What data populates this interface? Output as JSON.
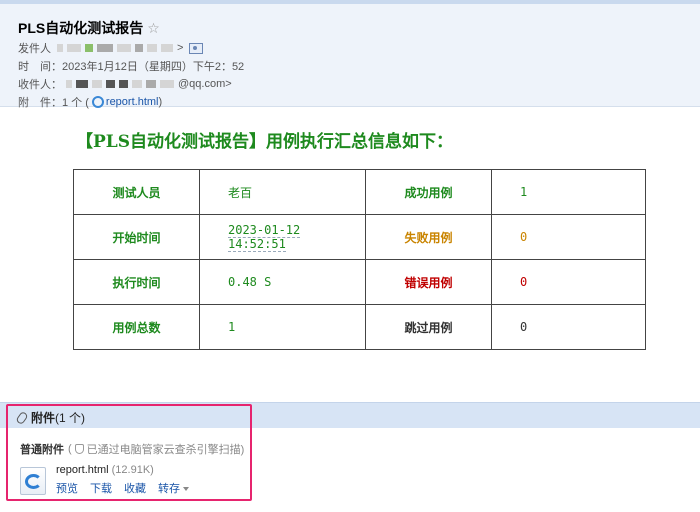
{
  "mail": {
    "subject": "PLS自动化测试报告",
    "star_icon": "☆",
    "sender_label": "发件人",
    "sender_suffix": ">",
    "time_label": "时　间：",
    "time_value": "2023年1月12日（星期四）下午2：52",
    "recipient_label": "收件人：",
    "recipient_suffix": "@qq.com>",
    "attachment_label": "附　件：",
    "attachment_count": "1 个 (",
    "attachment_file": "report.html",
    "attachment_close": ")"
  },
  "report": {
    "title": "【PLS自动化测试报告】用例执行汇总信息如下：",
    "rows": [
      {
        "k1": "测试人员",
        "v1": "老百",
        "k2": "成功用例",
        "v2": "1"
      },
      {
        "k1": "开始时间",
        "v1": "2023-01-12 14:52:51",
        "k2": "失败用例",
        "v2": "0"
      },
      {
        "k1": "执行时间",
        "v1": "0.48 S",
        "k2": "错误用例",
        "v2": "0"
      },
      {
        "k1": "用例总数",
        "v1": "1",
        "k2": "跳过用例",
        "v2": "0"
      }
    ]
  },
  "attachments": {
    "title": "附件",
    "count": "(1 个)",
    "normal_label": "普通附件",
    "scan_prefix": "(",
    "scan_text": "已通过电脑管家云查杀引擎扫描)",
    "file": {
      "name": "report.html",
      "size": "(12.91K)",
      "actions": [
        "预览",
        "下载",
        "收藏",
        "转存"
      ]
    }
  },
  "colors": {
    "green": "#1e8a1e",
    "orange": "#c98400",
    "red": "#c00000",
    "highlight": "#e6246e"
  }
}
